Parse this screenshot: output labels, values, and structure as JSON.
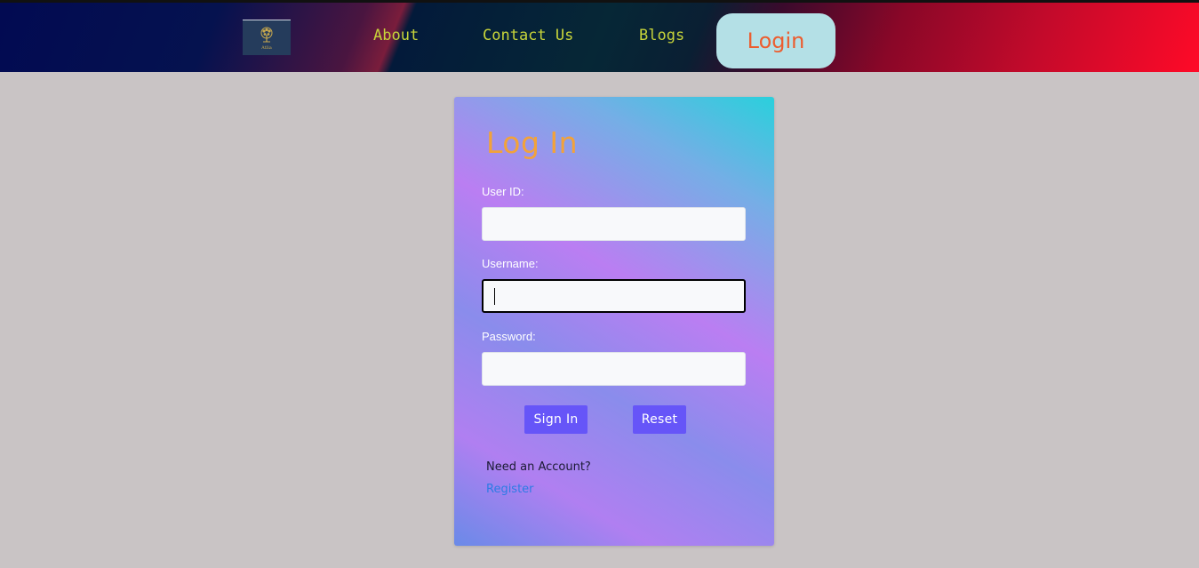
{
  "navbar": {
    "logo_text": "Atlia",
    "links": [
      "About",
      "Contact Us",
      "Blogs"
    ],
    "login_label": "Login"
  },
  "form": {
    "title": "Log In",
    "fields": [
      {
        "label": "User ID:",
        "value": "",
        "placeholder": ""
      },
      {
        "label": "Username:",
        "value": "",
        "placeholder": ""
      },
      {
        "label": "Password:",
        "value": "",
        "placeholder": ""
      }
    ],
    "sign_in_label": "Sign In",
    "reset_label": "Reset",
    "need_account": "Need an Account?",
    "register_label": "Register"
  },
  "colors": {
    "nav_link": "#c7d43a",
    "login_text": "#ec5d2f",
    "title": "#f2a23a",
    "button_bg": "#6655f8",
    "register_link": "#2c7be5",
    "page_bg": "#c9c4c5"
  }
}
